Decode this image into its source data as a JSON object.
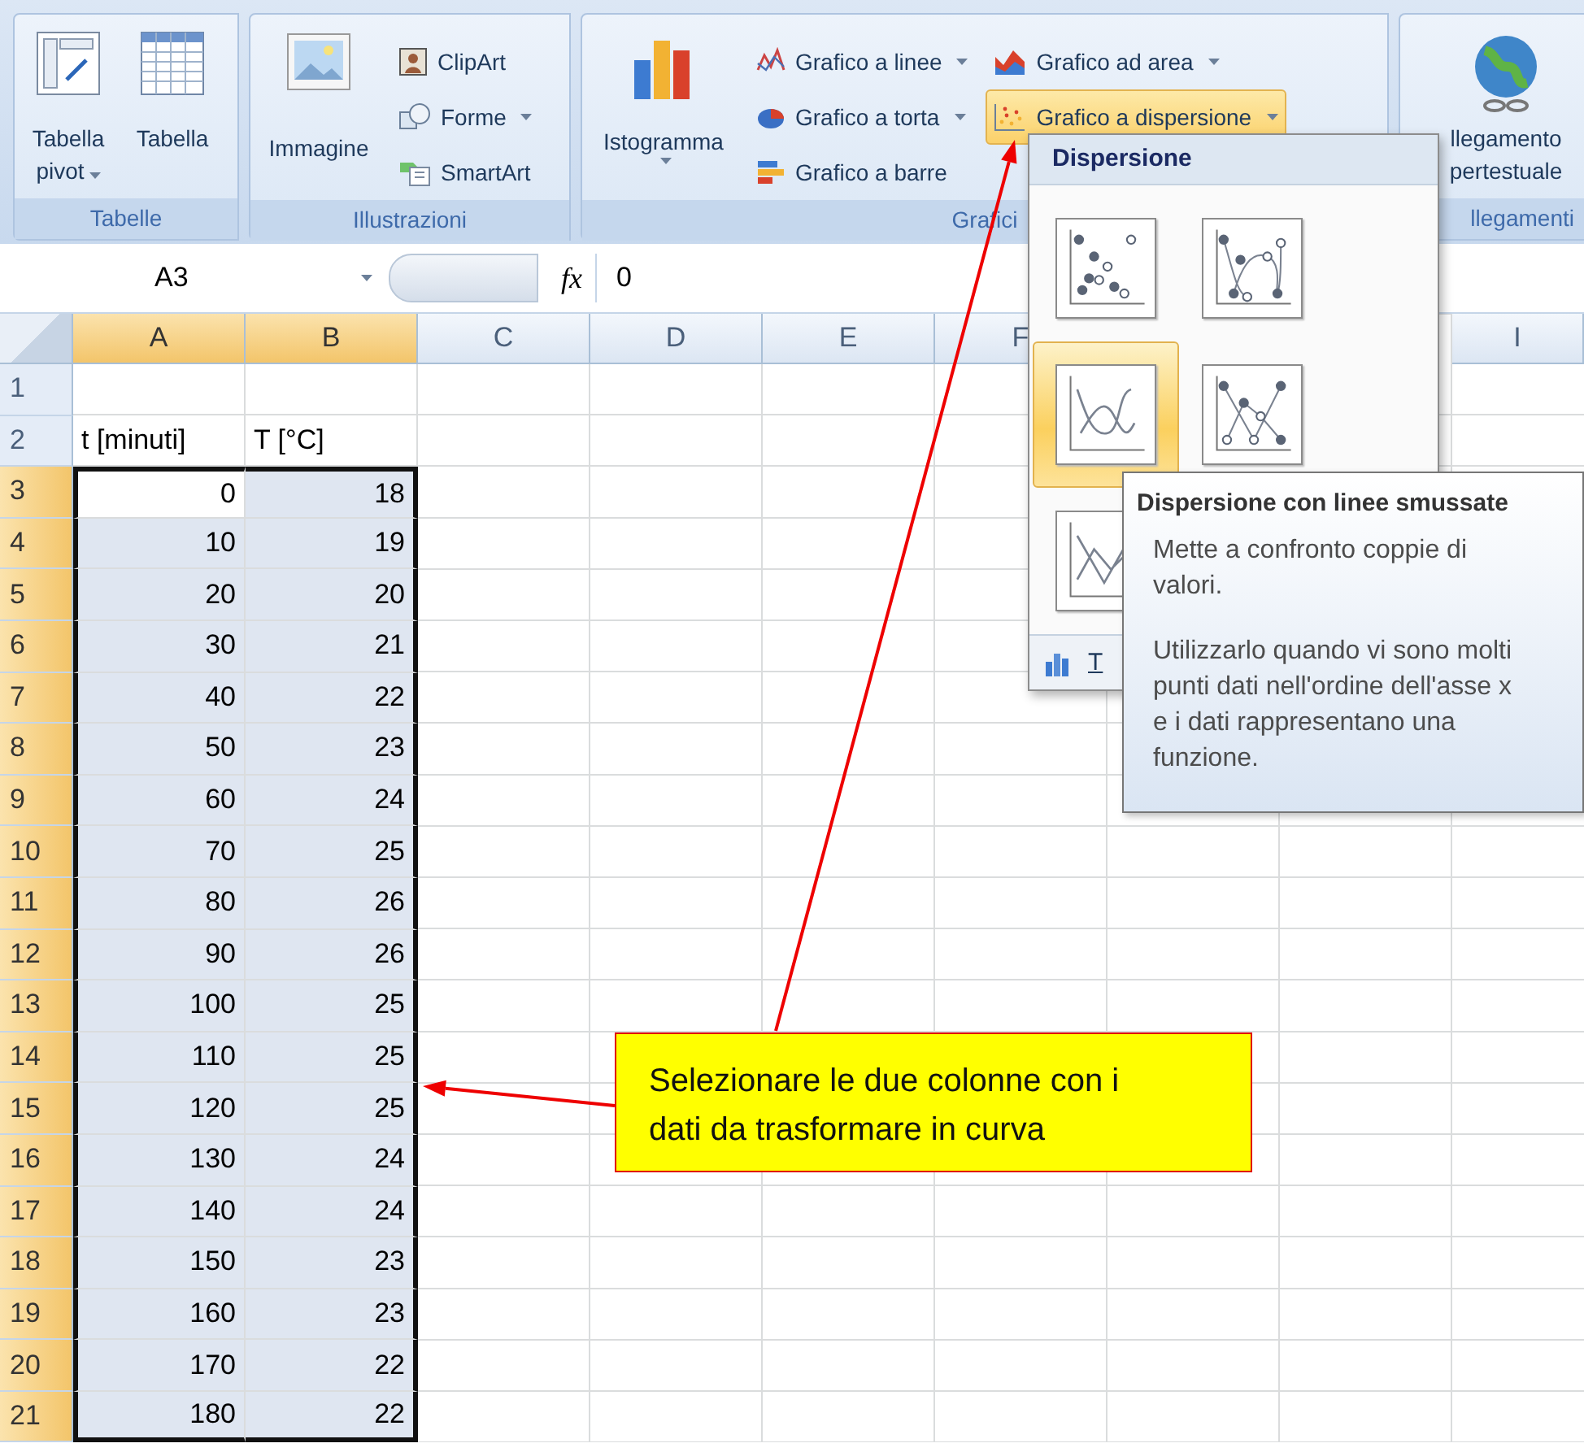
{
  "ribbon": {
    "tables_group": {
      "label": "Tabelle",
      "buttons": [
        {
          "label": "Tabella pivot",
          "menu": true
        },
        {
          "label": "Tabella",
          "menu": false
        }
      ]
    },
    "illustrations_group": {
      "label": "Illustrazioni",
      "large": {
        "label": "Immagine"
      },
      "small": [
        {
          "label": "ClipArt",
          "menu": false
        },
        {
          "label": "Forme",
          "menu": true
        },
        {
          "label": "SmartArt",
          "menu": false
        }
      ]
    },
    "charts_group": {
      "label": "Grafici",
      "large": {
        "label": "Istogramma",
        "menu": true
      },
      "small": [
        {
          "label": "Grafico a linee",
          "menu": true,
          "selected": false
        },
        {
          "label": "Grafico a torta",
          "menu": true,
          "selected": false
        },
        {
          "label": "Grafico a barre",
          "menu": false,
          "selected": false
        },
        {
          "label": "Grafico ad area",
          "menu": true,
          "selected": false
        },
        {
          "label": "Grafico a dispersione",
          "menu": true,
          "selected": true
        }
      ]
    },
    "links_group": {
      "label": "llegamenti",
      "button": {
        "lines": [
          "llegamento",
          "pertestuale"
        ]
      }
    }
  },
  "formula_bar": {
    "name_box": "A3",
    "function_label": "fx",
    "value": "0"
  },
  "sheet": {
    "columns": [
      {
        "letter": "A",
        "selected": true
      },
      {
        "letter": "B",
        "selected": true
      },
      {
        "letter": "C",
        "selected": false
      },
      {
        "letter": "D",
        "selected": false
      },
      {
        "letter": "E",
        "selected": false
      },
      {
        "letter": "F",
        "selected": false
      }
    ],
    "far_column": {
      "letter": "I",
      "selected": false
    },
    "rows": [
      {
        "number": "1",
        "kind": "blank",
        "selected": false,
        "active": false
      },
      {
        "number": "2",
        "kind": "label",
        "selected": false,
        "active": false,
        "cells": [
          "t [minuti]",
          "T [°C]"
        ]
      },
      {
        "number": "3",
        "kind": "value",
        "selected": true,
        "active": true,
        "cells": [
          "0",
          "18"
        ]
      },
      {
        "number": "4",
        "kind": "value",
        "selected": true,
        "active": false,
        "cells": [
          "10",
          "19"
        ]
      },
      {
        "number": "5",
        "kind": "value",
        "selected": true,
        "active": false,
        "cells": [
          "20",
          "20"
        ]
      },
      {
        "number": "6",
        "kind": "value",
        "selected": true,
        "active": false,
        "cells": [
          "30",
          "21"
        ]
      },
      {
        "number": "7",
        "kind": "value",
        "selected": true,
        "active": false,
        "cells": [
          "40",
          "22"
        ]
      },
      {
        "number": "8",
        "kind": "value",
        "selected": true,
        "active": false,
        "cells": [
          "50",
          "23"
        ]
      },
      {
        "number": "9",
        "kind": "value",
        "selected": true,
        "active": false,
        "cells": [
          "60",
          "24"
        ]
      },
      {
        "number": "10",
        "kind": "value",
        "selected": true,
        "active": false,
        "cells": [
          "70",
          "25"
        ]
      },
      {
        "number": "11",
        "kind": "value",
        "selected": true,
        "active": false,
        "cells": [
          "80",
          "26"
        ]
      },
      {
        "number": "12",
        "kind": "value",
        "selected": true,
        "active": false,
        "cells": [
          "90",
          "26"
        ]
      },
      {
        "number": "13",
        "kind": "value",
        "selected": true,
        "active": false,
        "cells": [
          "100",
          "25"
        ]
      },
      {
        "number": "14",
        "kind": "value",
        "selected": true,
        "active": false,
        "cells": [
          "110",
          "25"
        ]
      },
      {
        "number": "15",
        "kind": "value",
        "selected": true,
        "active": false,
        "cells": [
          "120",
          "25"
        ]
      },
      {
        "number": "16",
        "kind": "value",
        "selected": true,
        "active": false,
        "cells": [
          "130",
          "24"
        ]
      },
      {
        "number": "17",
        "kind": "value",
        "selected": true,
        "active": false,
        "cells": [
          "140",
          "24"
        ]
      },
      {
        "number": "18",
        "kind": "value",
        "selected": true,
        "active": false,
        "cells": [
          "150",
          "23"
        ]
      },
      {
        "number": "19",
        "kind": "value",
        "selected": true,
        "active": false,
        "cells": [
          "160",
          "23"
        ]
      },
      {
        "number": "20",
        "kind": "value",
        "selected": true,
        "active": false,
        "cells": [
          "170",
          "22"
        ]
      },
      {
        "number": "21",
        "kind": "value",
        "selected": true,
        "active": false,
        "cells": [
          "180",
          "22"
        ]
      }
    ]
  },
  "chart_menu": {
    "title": "Dispersione",
    "options": [
      {
        "kind": "markers",
        "selected": false
      },
      {
        "kind": "smooth_markers",
        "selected": false
      },
      {
        "kind": "smooth",
        "selected": true
      },
      {
        "kind": "straight_markers",
        "selected": false
      },
      {
        "kind": "straight",
        "selected": false
      }
    ],
    "footer_label": "T"
  },
  "tooltip": {
    "title": "Dispersione con linee smussate",
    "paragraphs": [
      "Mette a confronto coppie di valori.",
      "Utilizzarlo quando vi sono molti punti dati nell'ordine dell'asse x e i dati rappresentano una funzione."
    ]
  },
  "callout": {
    "text": "Selezionare le due colonne con i dati da trasformare in curva"
  }
}
